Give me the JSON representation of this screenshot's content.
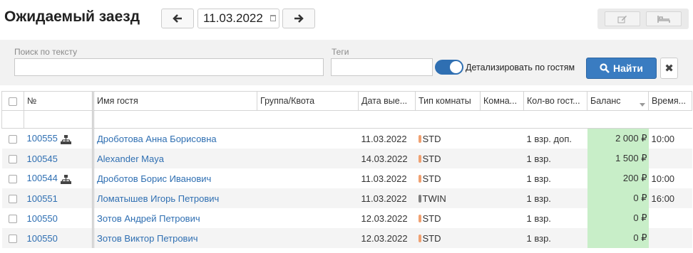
{
  "header": {
    "title": "Ожидаемый заезд",
    "date": "11.03.2022"
  },
  "filters": {
    "search_label": "Поиск по тексту",
    "tags_label": "Теги",
    "detail_label": "Детализировать по гостям",
    "detail_on": true,
    "find_label": "Найти"
  },
  "colors": {
    "accent": "#3a7cc1",
    "balance_bg": "#c8eec8",
    "std_tag": "#f0a070",
    "twin_tag": "#808080"
  },
  "table": {
    "columns": [
      "№",
      "Имя гостя",
      "Группа/Квота",
      "Дата вые...",
      "Тип комнаты",
      "Комна...",
      "Кол-во гост...",
      "Баланс",
      "Время..."
    ],
    "rows": [
      {
        "id": "100555",
        "group_icon": true,
        "name": "Дроботова Анна Борисовна",
        "date": "11.03.2022",
        "room_type": "STD",
        "guests": "1 взр. доп.",
        "balance": "2 000 ₽",
        "time": "10:00"
      },
      {
        "id": "100545",
        "group_icon": false,
        "name": "Alexander Maya",
        "date": "14.03.2022",
        "room_type": "STD",
        "guests": "1 взр.",
        "balance": "1 500 ₽",
        "time": ""
      },
      {
        "id": "100544",
        "group_icon": true,
        "name": "Дроботов Борис Иванович",
        "date": "11.03.2022",
        "room_type": "STD",
        "guests": "1 взр.",
        "balance": "200 ₽",
        "time": "10:00"
      },
      {
        "id": "100551",
        "group_icon": false,
        "name": "Ломатышев Игорь Петрович",
        "date": "11.03.2022",
        "room_type": "TWIN",
        "guests": "1 взр.",
        "balance": "0 ₽",
        "time": "16:00"
      },
      {
        "id": "100550",
        "group_icon": false,
        "name": "Зотов Андрей Петрович",
        "date": "12.03.2022",
        "room_type": "STD",
        "guests": "1 взр.",
        "balance": "0 ₽",
        "time": ""
      },
      {
        "id": "100550",
        "group_icon": false,
        "name": "Зотов Виктор Петрович",
        "date": "12.03.2022",
        "room_type": "STD",
        "guests": "1 взр.",
        "balance": "0 ₽",
        "time": ""
      }
    ]
  }
}
